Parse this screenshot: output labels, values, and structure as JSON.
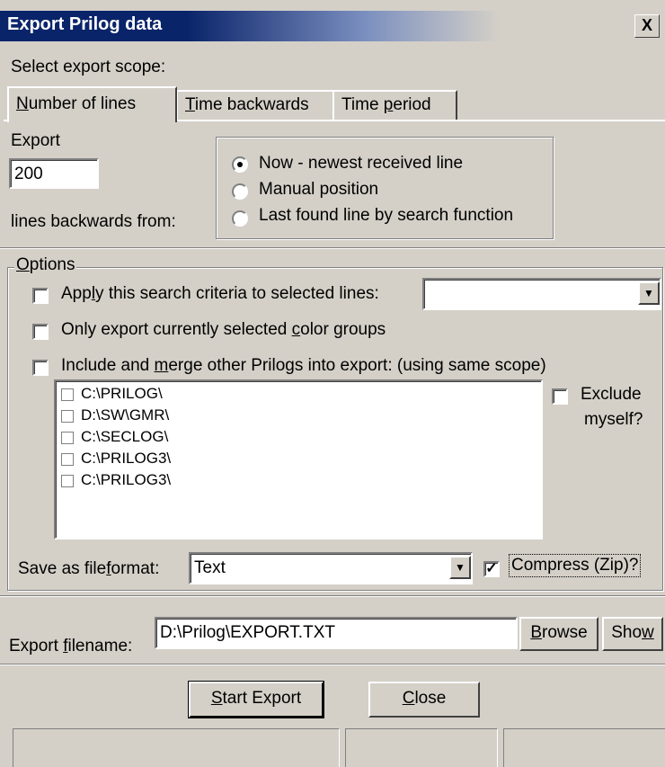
{
  "window": {
    "title": "Export Prilog data",
    "close_glyph": "X"
  },
  "scope": {
    "label": "Select export scope:",
    "tabs": [
      {
        "pre": "",
        "key": "N",
        "post": "umber of lines"
      },
      {
        "pre": "",
        "key": "T",
        "post": "ime backwards"
      },
      {
        "pre": "Time ",
        "key": "p",
        "post": "eriod"
      }
    ],
    "export_label": "Export",
    "lines_value": "200",
    "lines_from_label": "lines backwards from:",
    "radios": [
      {
        "label": "Now - newest received line",
        "checked": true
      },
      {
        "label": "Manual position",
        "checked": false
      },
      {
        "label": "Last found line by search function",
        "checked": false
      }
    ]
  },
  "options": {
    "legend_key": "O",
    "legend_rest": "ptions",
    "apply": {
      "pre": "App",
      "key": "l",
      "post": "y this search criteria to selected lines:",
      "checked": false,
      "value": ""
    },
    "only_color": {
      "pre": "Only export currently selected ",
      "key": "c",
      "post": "olor groups",
      "checked": false
    },
    "include": {
      "pre": "Include and ",
      "key": "m",
      "post": "erge other Prilogs into export: (using same scope)",
      "checked": false
    },
    "prilogs": [
      {
        "path": "C:\\PRILOG\\",
        "checked": false
      },
      {
        "path": "D:\\SW\\GMR\\",
        "checked": false
      },
      {
        "path": "C:\\SECLOG\\",
        "checked": false
      },
      {
        "path": "C:\\PRILOG3\\",
        "checked": false
      },
      {
        "path": "C:\\PRILOG3\\",
        "checked": false
      }
    ],
    "exclude_line1": "Exclude",
    "exclude_line2": "myself?",
    "format_pre": "Save as file",
    "format_key": "f",
    "format_post": "ormat:",
    "format_value": "Text",
    "compress_label": "Compress (Zip)?",
    "compress_checked": true
  },
  "filename": {
    "pre": "Export ",
    "key": "f",
    "post": "ilename:",
    "value": "D:\\Prilog\\EXPORT.TXT",
    "browse_key": "B",
    "browse_rest": "rowse",
    "show_pre": "Sho",
    "show_key": "w"
  },
  "actions": {
    "start_key": "S",
    "start_rest": "tart Export",
    "close_key": "C",
    "close_rest": "lose"
  },
  "glyphs": {
    "dropdown": "▼",
    "check": "✓"
  }
}
